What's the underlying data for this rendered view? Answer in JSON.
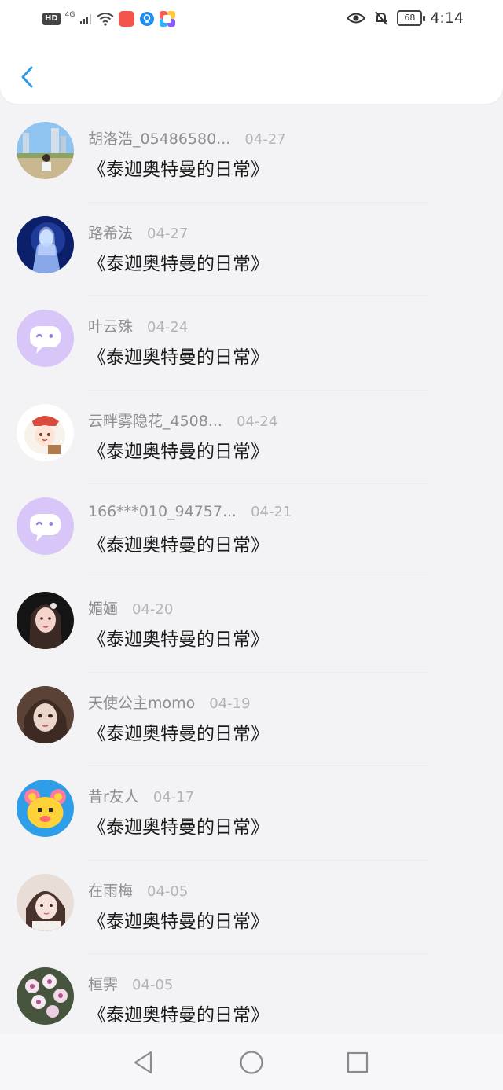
{
  "status_bar": {
    "network_badge": "HD",
    "network_type": "4G",
    "battery_level": "68",
    "time": "4:14"
  },
  "nav": {
    "back_icon": "chevron-left-icon",
    "accent_color": "#2f9be8"
  },
  "items": [
    {
      "name": "胡洛浩_05486580...",
      "date": "04-27",
      "title": "《泰迦奥特曼的日常》",
      "avatar": "photo-city"
    },
    {
      "name": "路希法",
      "date": "04-27",
      "title": "《泰迦奥特曼的日常》",
      "avatar": "photo-ghost"
    },
    {
      "name": "叶云殊",
      "date": "04-24",
      "title": "《泰迦奥特曼的日常》",
      "avatar": "default-chat-avatar"
    },
    {
      "name": "云畔雾隐花_4508...",
      "date": "04-24",
      "title": "《泰迦奥特曼的日常》",
      "avatar": "cartoon-girl"
    },
    {
      "name": "166***010_94757...",
      "date": "04-21",
      "title": "《泰迦奥特曼的日常》",
      "avatar": "default-chat-avatar"
    },
    {
      "name": "媚婳",
      "date": "04-20",
      "title": "《泰迦奥特曼的日常》",
      "avatar": "portrait-dark"
    },
    {
      "name": "天使公主momo",
      "date": "04-19",
      "title": "《泰迦奥特曼的日常》",
      "avatar": "portrait-doll"
    },
    {
      "name": "昔r友人",
      "date": "04-17",
      "title": "《泰迦奥特曼的日常》",
      "avatar": "pixel-bear"
    },
    {
      "name": "在雨梅",
      "date": "04-05",
      "title": "《泰迦奥特曼的日常》",
      "avatar": "portrait-girl"
    },
    {
      "name": "桓霁",
      "date": "04-05",
      "title": "《泰迦奥特曼的日常》",
      "avatar": "photo-orchid"
    }
  ],
  "system_nav": {
    "back": "triangle-back-icon",
    "home": "circle-home-icon",
    "recents": "square-recents-icon"
  }
}
